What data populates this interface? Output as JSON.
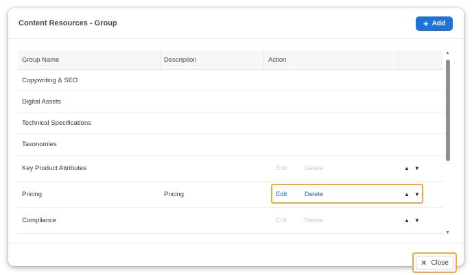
{
  "dialog": {
    "title": "Content Resources - Group",
    "add_label": "Add",
    "close_label": "Close"
  },
  "table": {
    "headers": [
      "Group Name",
      "Description",
      "Action"
    ],
    "rows": [
      {
        "name": "Copywriting & SEO",
        "description": "",
        "edit": "",
        "delete": ""
      },
      {
        "name": "Digital Assets",
        "description": "",
        "edit": "",
        "delete": ""
      },
      {
        "name": "Technical Specifications",
        "description": "",
        "edit": "",
        "delete": ""
      },
      {
        "name": "Taxonomies",
        "description": "",
        "edit": "",
        "delete": ""
      },
      {
        "name": "Key Product Attributes",
        "description": "",
        "edit": "Edit",
        "delete": "Delete"
      },
      {
        "name": "Pricing",
        "description": "Pricing",
        "edit": "Edit",
        "delete": "Delete"
      },
      {
        "name": "Compliance",
        "description": "",
        "edit": "Edit",
        "delete": "Delete"
      }
    ]
  },
  "colors": {
    "accent": "#1f73d6",
    "highlight": "#f0a93a",
    "link_active": "#1f5fbf",
    "link_disabled": "#c9cdd2"
  }
}
